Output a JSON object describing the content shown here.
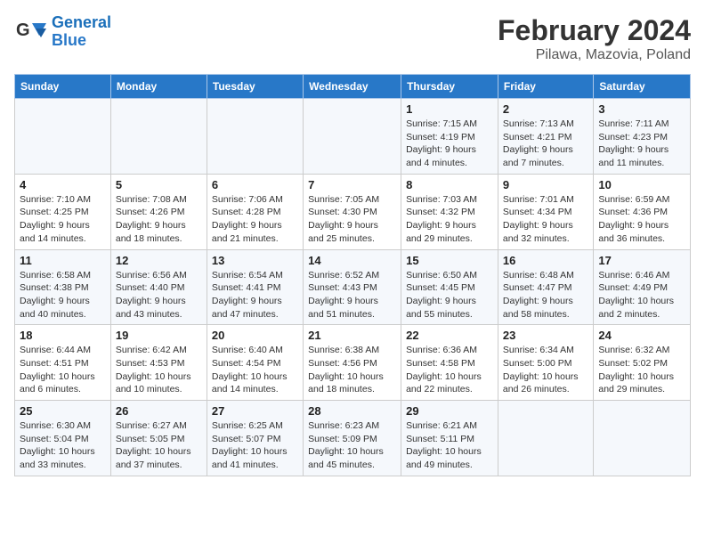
{
  "logo": {
    "line1": "General",
    "line2": "Blue"
  },
  "title": "February 2024",
  "subtitle": "Pilawa, Mazovia, Poland",
  "weekdays": [
    "Sunday",
    "Monday",
    "Tuesday",
    "Wednesday",
    "Thursday",
    "Friday",
    "Saturday"
  ],
  "weeks": [
    [
      {
        "day": "",
        "info": ""
      },
      {
        "day": "",
        "info": ""
      },
      {
        "day": "",
        "info": ""
      },
      {
        "day": "",
        "info": ""
      },
      {
        "day": "1",
        "info": "Sunrise: 7:15 AM\nSunset: 4:19 PM\nDaylight: 9 hours\nand 4 minutes."
      },
      {
        "day": "2",
        "info": "Sunrise: 7:13 AM\nSunset: 4:21 PM\nDaylight: 9 hours\nand 7 minutes."
      },
      {
        "day": "3",
        "info": "Sunrise: 7:11 AM\nSunset: 4:23 PM\nDaylight: 9 hours\nand 11 minutes."
      }
    ],
    [
      {
        "day": "4",
        "info": "Sunrise: 7:10 AM\nSunset: 4:25 PM\nDaylight: 9 hours\nand 14 minutes."
      },
      {
        "day": "5",
        "info": "Sunrise: 7:08 AM\nSunset: 4:26 PM\nDaylight: 9 hours\nand 18 minutes."
      },
      {
        "day": "6",
        "info": "Sunrise: 7:06 AM\nSunset: 4:28 PM\nDaylight: 9 hours\nand 21 minutes."
      },
      {
        "day": "7",
        "info": "Sunrise: 7:05 AM\nSunset: 4:30 PM\nDaylight: 9 hours\nand 25 minutes."
      },
      {
        "day": "8",
        "info": "Sunrise: 7:03 AM\nSunset: 4:32 PM\nDaylight: 9 hours\nand 29 minutes."
      },
      {
        "day": "9",
        "info": "Sunrise: 7:01 AM\nSunset: 4:34 PM\nDaylight: 9 hours\nand 32 minutes."
      },
      {
        "day": "10",
        "info": "Sunrise: 6:59 AM\nSunset: 4:36 PM\nDaylight: 9 hours\nand 36 minutes."
      }
    ],
    [
      {
        "day": "11",
        "info": "Sunrise: 6:58 AM\nSunset: 4:38 PM\nDaylight: 9 hours\nand 40 minutes."
      },
      {
        "day": "12",
        "info": "Sunrise: 6:56 AM\nSunset: 4:40 PM\nDaylight: 9 hours\nand 43 minutes."
      },
      {
        "day": "13",
        "info": "Sunrise: 6:54 AM\nSunset: 4:41 PM\nDaylight: 9 hours\nand 47 minutes."
      },
      {
        "day": "14",
        "info": "Sunrise: 6:52 AM\nSunset: 4:43 PM\nDaylight: 9 hours\nand 51 minutes."
      },
      {
        "day": "15",
        "info": "Sunrise: 6:50 AM\nSunset: 4:45 PM\nDaylight: 9 hours\nand 55 minutes."
      },
      {
        "day": "16",
        "info": "Sunrise: 6:48 AM\nSunset: 4:47 PM\nDaylight: 9 hours\nand 58 minutes."
      },
      {
        "day": "17",
        "info": "Sunrise: 6:46 AM\nSunset: 4:49 PM\nDaylight: 10 hours\nand 2 minutes."
      }
    ],
    [
      {
        "day": "18",
        "info": "Sunrise: 6:44 AM\nSunset: 4:51 PM\nDaylight: 10 hours\nand 6 minutes."
      },
      {
        "day": "19",
        "info": "Sunrise: 6:42 AM\nSunset: 4:53 PM\nDaylight: 10 hours\nand 10 minutes."
      },
      {
        "day": "20",
        "info": "Sunrise: 6:40 AM\nSunset: 4:54 PM\nDaylight: 10 hours\nand 14 minutes."
      },
      {
        "day": "21",
        "info": "Sunrise: 6:38 AM\nSunset: 4:56 PM\nDaylight: 10 hours\nand 18 minutes."
      },
      {
        "day": "22",
        "info": "Sunrise: 6:36 AM\nSunset: 4:58 PM\nDaylight: 10 hours\nand 22 minutes."
      },
      {
        "day": "23",
        "info": "Sunrise: 6:34 AM\nSunset: 5:00 PM\nDaylight: 10 hours\nand 26 minutes."
      },
      {
        "day": "24",
        "info": "Sunrise: 6:32 AM\nSunset: 5:02 PM\nDaylight: 10 hours\nand 29 minutes."
      }
    ],
    [
      {
        "day": "25",
        "info": "Sunrise: 6:30 AM\nSunset: 5:04 PM\nDaylight: 10 hours\nand 33 minutes."
      },
      {
        "day": "26",
        "info": "Sunrise: 6:27 AM\nSunset: 5:05 PM\nDaylight: 10 hours\nand 37 minutes."
      },
      {
        "day": "27",
        "info": "Sunrise: 6:25 AM\nSunset: 5:07 PM\nDaylight: 10 hours\nand 41 minutes."
      },
      {
        "day": "28",
        "info": "Sunrise: 6:23 AM\nSunset: 5:09 PM\nDaylight: 10 hours\nand 45 minutes."
      },
      {
        "day": "29",
        "info": "Sunrise: 6:21 AM\nSunset: 5:11 PM\nDaylight: 10 hours\nand 49 minutes."
      },
      {
        "day": "",
        "info": ""
      },
      {
        "day": "",
        "info": ""
      }
    ]
  ]
}
